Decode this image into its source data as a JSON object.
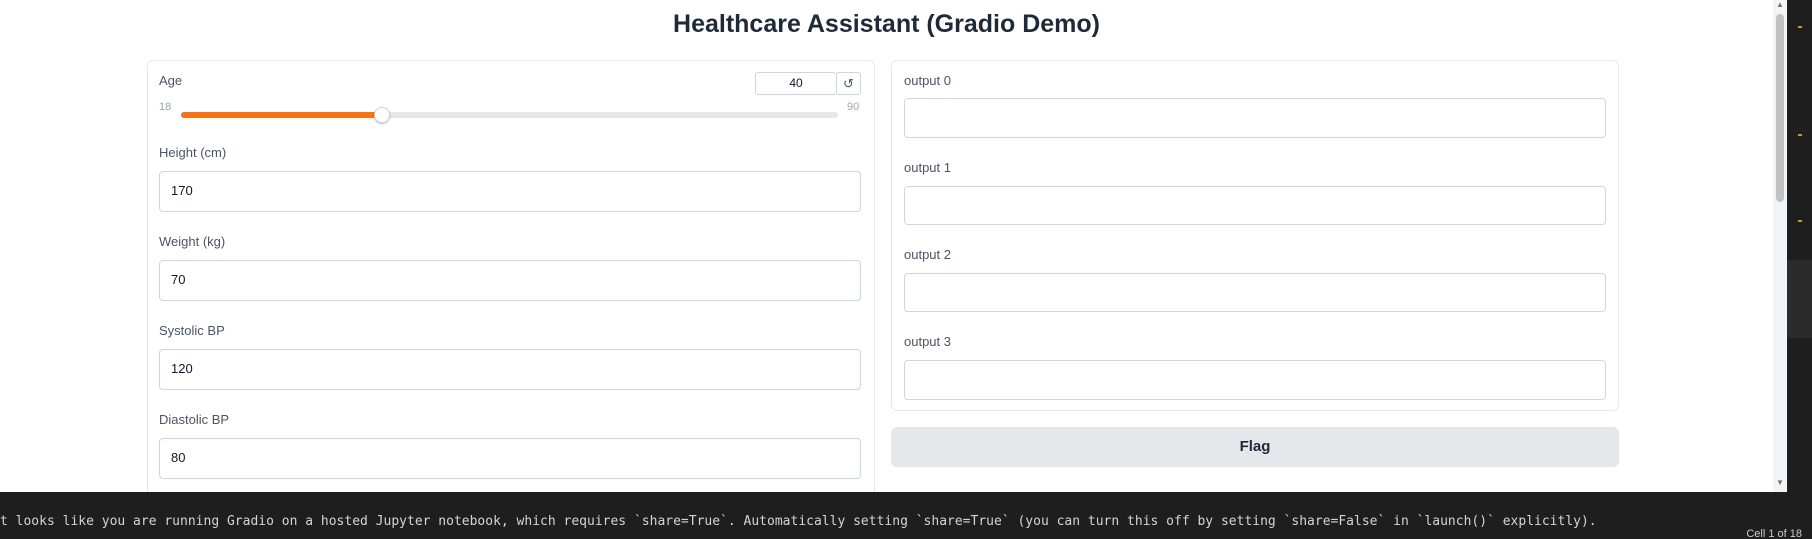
{
  "app": {
    "title": "Healthcare Assistant (Gradio Demo)"
  },
  "inputs": {
    "age": {
      "label": "Age",
      "value": "40",
      "min": "18",
      "max": "90",
      "fraction": 0.306,
      "reset_icon": "↺"
    },
    "height": {
      "label": "Height (cm)",
      "value": "170"
    },
    "weight": {
      "label": "Weight (kg)",
      "value": "70"
    },
    "systolic": {
      "label": "Systolic BP",
      "value": "120"
    },
    "diastolic": {
      "label": "Diastolic BP",
      "value": "80"
    }
  },
  "outputs": [
    {
      "label": "output 0",
      "value": ""
    },
    {
      "label": "output 1",
      "value": ""
    },
    {
      "label": "output 2",
      "value": ""
    },
    {
      "label": "output 3",
      "value": ""
    }
  ],
  "flag_button": "Flag",
  "console": {
    "message": "t looks like you are running Gradio on a hosted Jupyter notebook, which requires `share=True`. Automatically setting `share=True` (you can turn this off by setting `share=False` in `launch()` explicitly).",
    "status": "Cell 1 of 18"
  },
  "colors": {
    "accent": "#f97316",
    "flag_bg": "#e5e7eb",
    "console_bg": "#1e1e1e"
  }
}
